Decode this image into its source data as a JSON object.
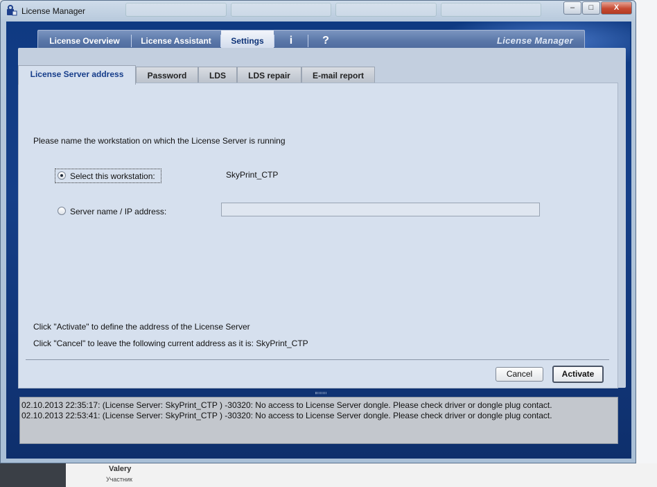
{
  "window": {
    "title": "License Manager",
    "minimize": "–",
    "maximize": "□",
    "close": "X"
  },
  "nav": {
    "items": [
      {
        "label": "License Overview"
      },
      {
        "label": "License Assistant"
      },
      {
        "label": "Settings"
      },
      {
        "label": "i"
      },
      {
        "label": "?"
      }
    ],
    "brand": "License Manager"
  },
  "tabs": [
    {
      "label": "License Server address"
    },
    {
      "label": "Password"
    },
    {
      "label": "LDS"
    },
    {
      "label": "LDS repair"
    },
    {
      "label": "E-mail report"
    }
  ],
  "settings": {
    "prompt": "Please name the workstation on which the License Server is running",
    "option_this_workstation": "Select this workstation:",
    "workstation_name": "SkyPrint_CTP",
    "option_server_name": "Server name / IP address:",
    "server_input_value": "",
    "hint_activate": "Click \"Activate\" to define the address of the License Server",
    "hint_cancel": "Click \"Cancel\" to leave the following current address as it is:  SkyPrint_CTP",
    "cancel_label": "Cancel",
    "activate_label": "Activate"
  },
  "log": {
    "lines": [
      "02.10.2013 22:35:17: (License Server: SkyPrint_CTP )  -30320: No access to License Server dongle. Please check driver or dongle plug contact.",
      "02.10.2013 22:53:41: (License Server: SkyPrint_CTP )  -30320: No access to License Server dongle. Please check driver or dongle plug contact."
    ]
  },
  "background": {
    "user_name": "Valery",
    "user_role": "Участник"
  },
  "colors": {
    "accent_blue": "#0f3a82",
    "panel": "#d6e0ee",
    "active_tab_text": "#163d8a"
  }
}
